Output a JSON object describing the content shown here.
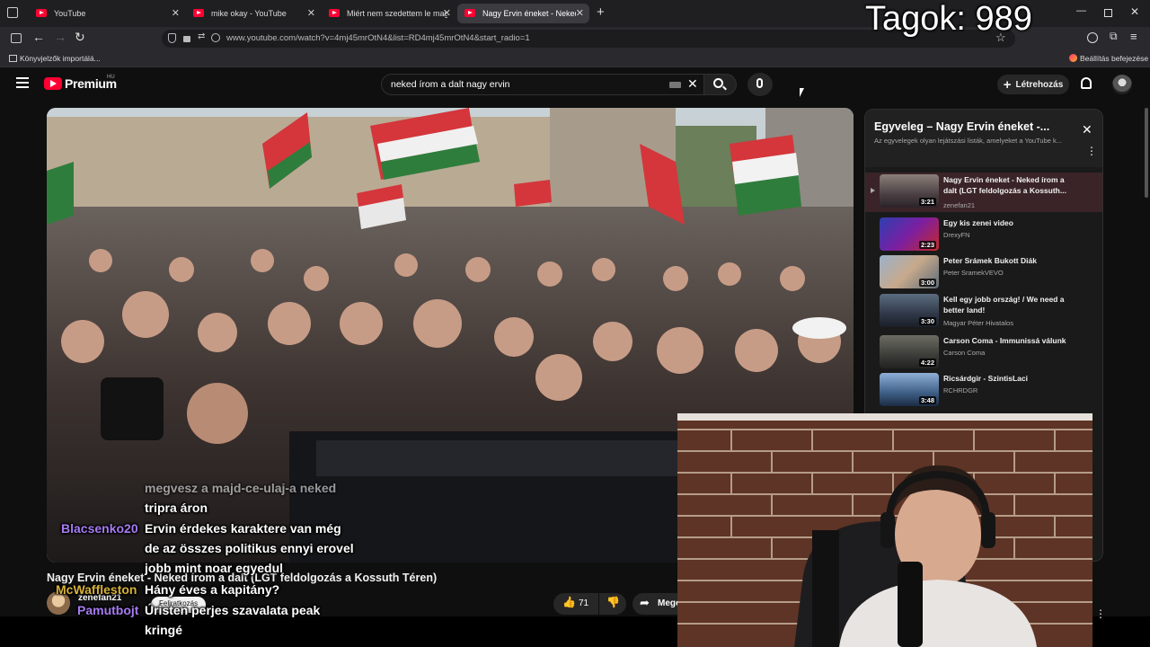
{
  "browser": {
    "tabs": [
      {
        "label": "YouTube",
        "active": false
      },
      {
        "label": "mike okay - YouTube",
        "active": false
      },
      {
        "label": "Miért nem szedettem le magam",
        "active": false
      },
      {
        "label": "Nagy Ervin éneket - Neked írom",
        "active": true
      }
    ],
    "url": "www.youtube.com/watch?v=4mj45mrOtN4&list=RD4mj45mrOtN4&start_radio=1",
    "bookmarks_import": "Könyvjelzők importálá...",
    "setup_finish": "Beállítás befejezése"
  },
  "youtube": {
    "logo_text": "Premium",
    "logo_region": "HU",
    "search_value": "neked írom a dalt nagy ervin",
    "create_label": "Létrehozás",
    "video_title": "Nagy Ervin éneket - Neked írom a dalt (LGT feldolgozás a Kossuth Téren)",
    "channel": "zenefan21",
    "subscribe_label": "Feliratkozás",
    "like_count": "71",
    "share_label": "Megosztás"
  },
  "playlist": {
    "title": "Egyveleg – Nagy Ervin éneket -...",
    "subtitle": "Az egyvelegek olyan lejátszási listák, amelyeket a YouTube k...",
    "items": [
      {
        "title": "Nagy Ervin éneket - Neked írom a dalt (LGT feldolgozás a Kossuth...",
        "channel": "zenefan21",
        "duration": "3:21",
        "current": true
      },
      {
        "title": "Egy kis zenei video",
        "channel": "DrexyFN",
        "duration": "2:23",
        "current": false
      },
      {
        "title": "Peter Srámek Bukott Diák",
        "channel": "Peter SramekVEVO",
        "duration": "3:00",
        "current": false
      },
      {
        "title": "Kell egy jobb ország! / We need a better land!",
        "channel": "Magyar Péter Hivatalos",
        "duration": "3:30",
        "current": false
      },
      {
        "title": "Carson Coma - Immunissá válunk",
        "channel": "Carson Coma",
        "duration": "4:22",
        "current": false
      },
      {
        "title": "Ricsárdgir - SzintisLaci",
        "channel": "RCHRDGR",
        "duration": "3:48",
        "current": false
      }
    ]
  },
  "overlay": {
    "members": "Tagok: 989"
  },
  "chat": [
    {
      "user": "",
      "message": "megvesz a majd-ce-ulaj-a neked"
    },
    {
      "user": "",
      "message": "tripra áron"
    },
    {
      "user": "Blacsenko20",
      "message": "Ervin érdekes karaktere van még"
    },
    {
      "user": "",
      "message": "de az összes politikus ennyi erovel"
    },
    {
      "user": "",
      "message": "jobb mint noar egyedul"
    },
    {
      "user": "McWaffleston",
      "message": "Hány éves a kapitány?"
    },
    {
      "user": "Pamutbojt",
      "message": "Úristen perjes szavalata peak"
    },
    {
      "user": "",
      "message": "kringé"
    }
  ],
  "colors": {
    "accent": "#ff0033",
    "chat_user": "#a77bf3",
    "playlist_current_bg": "#3a2427"
  }
}
